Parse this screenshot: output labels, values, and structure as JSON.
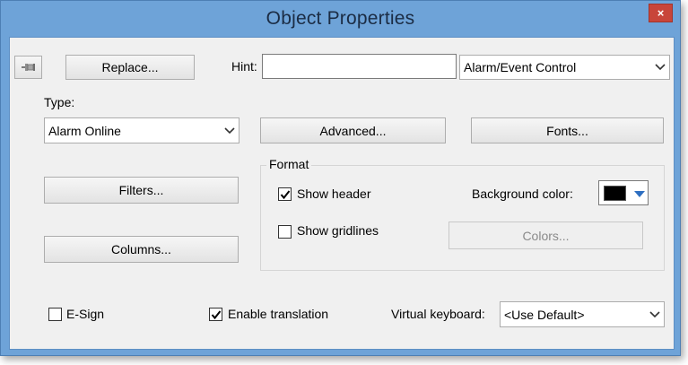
{
  "window": {
    "title": "Object Properties",
    "close_glyph": "×",
    "colors": {
      "frame": "#6ea3d8",
      "close": "#c8453a",
      "client": "#f0f0f0"
    }
  },
  "toolbar": {
    "pin_icon": "pushpin-icon",
    "replace_label": "Replace...",
    "hint_label": "Hint:",
    "hint_value": "",
    "object_type_selected": "Alarm/Event Control"
  },
  "type_section": {
    "label": "Type:",
    "selected": "Alarm Online",
    "advanced_label": "Advanced...",
    "fonts_label": "Fonts..."
  },
  "buttons": {
    "filters_label": "Filters...",
    "columns_label": "Columns..."
  },
  "format": {
    "group_label": "Format",
    "show_header_label": "Show header",
    "show_header_checked": true,
    "show_gridlines_label": "Show gridlines",
    "show_gridlines_checked": false,
    "background_color_label": "Background color:",
    "background_color_value": "#000000",
    "colors_label": "Colors..."
  },
  "footer": {
    "esign_label": "E-Sign",
    "esign_checked": false,
    "enable_translation_label": "Enable translation",
    "enable_translation_checked": true,
    "virtual_keyboard_label": "Virtual keyboard:",
    "virtual_keyboard_selected": "<Use Default>"
  }
}
